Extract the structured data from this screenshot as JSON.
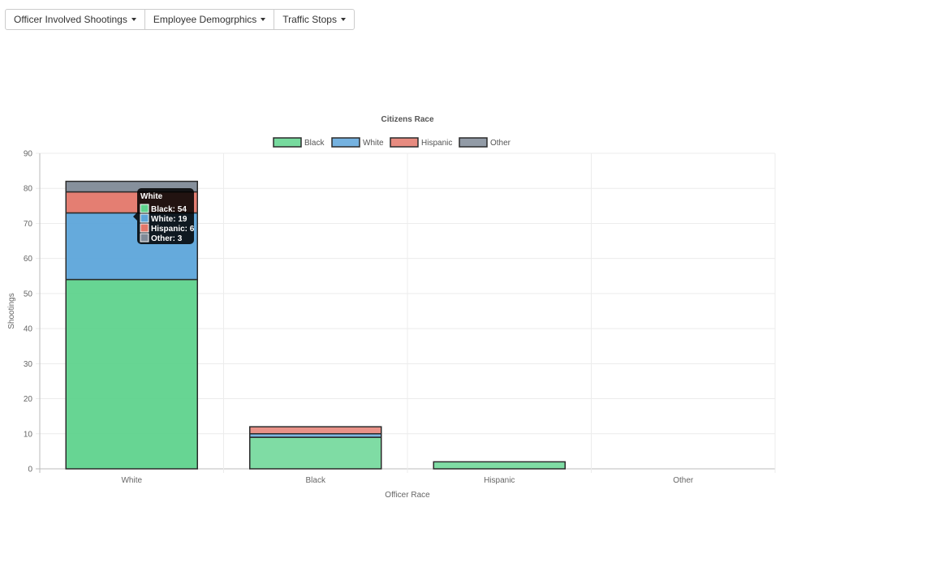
{
  "nav": {
    "buttons": [
      {
        "label": "Officer Involved Shootings"
      },
      {
        "label": "Employee Demogrphics"
      },
      {
        "label": "Traffic Stops"
      }
    ]
  },
  "chart_data": {
    "type": "bar",
    "stacked": true,
    "title": "Citizens Race",
    "xlabel": "Officer Race",
    "ylabel": "Shootings",
    "categories": [
      "White",
      "Black",
      "Hispanic",
      "Other"
    ],
    "ylim": [
      0,
      90
    ],
    "yticks": [
      0,
      10,
      20,
      30,
      40,
      50,
      60,
      70,
      80,
      90
    ],
    "grid": true,
    "legend_position": "top",
    "series": [
      {
        "name": "Black",
        "values": [
          54,
          9,
          2,
          0
        ],
        "color": "#5fd38d"
      },
      {
        "name": "White",
        "values": [
          19,
          1,
          0,
          0
        ],
        "color": "#5da5da"
      },
      {
        "name": "Hispanic",
        "values": [
          6,
          2,
          0,
          0
        ],
        "color": "#e3776a"
      },
      {
        "name": "Other",
        "values": [
          3,
          0,
          0,
          0
        ],
        "color": "#7f8a97"
      }
    ],
    "tooltip": {
      "title": "White",
      "items": [
        "Black: 54",
        "White: 19",
        "Hispanic: 6",
        "Other: 3"
      ]
    }
  }
}
